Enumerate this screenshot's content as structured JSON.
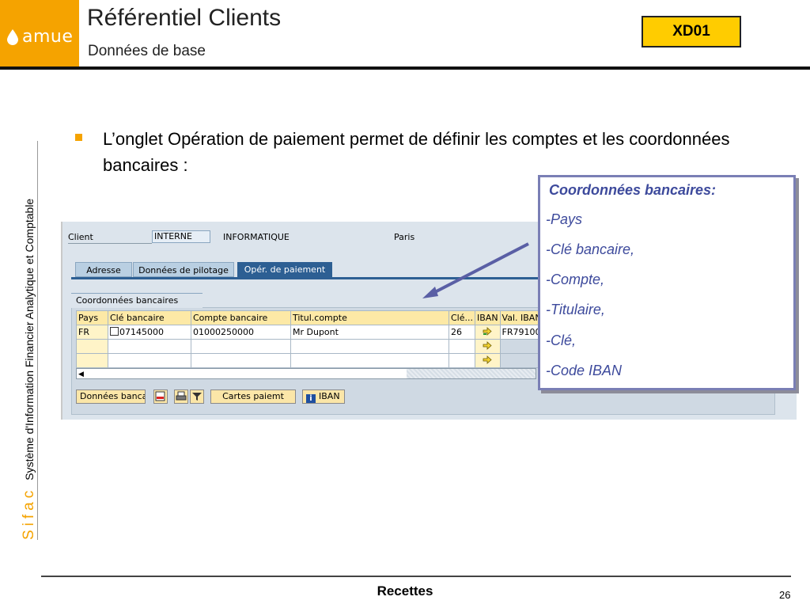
{
  "header": {
    "logo_text": "amue",
    "title": "Référentiel Clients",
    "subtitle": "Données de base",
    "transaction_code": "XD01"
  },
  "side": {
    "brand": "Sifac",
    "label": "Système d'Information Financier Analytique et Comptable"
  },
  "bullet_text": "L’onglet Opération de paiement permet de définir les comptes et les coordonnées bancaires :",
  "sap": {
    "client_label": "Client",
    "client_value": "INTERNE",
    "client_name": "INFORMATIQUE",
    "city": "Paris",
    "tabs": [
      {
        "label": "Adresse"
      },
      {
        "label": "Données de pilotage"
      },
      {
        "label": "Opér. de paiement",
        "active": true
      }
    ],
    "group_title": "Coordonnées bancaires",
    "table": {
      "headers": [
        "Pays",
        "Clé bancaire",
        "Compte bancaire",
        "Titul.compte",
        "Clé...",
        "IBAN",
        "Val. IBAN"
      ],
      "rows": [
        [
          "FR",
          "07145000",
          "01000250000",
          "Mr Dupont",
          "26",
          "",
          "FR79100"
        ],
        [
          "",
          "",
          "",
          "",
          "",
          "",
          ""
        ],
        [
          "",
          "",
          "",
          "",
          "",
          "",
          ""
        ]
      ]
    },
    "buttons": {
      "bank_data": "Données banca",
      "payment_cards": "Cartes paiemt",
      "iban": "IBAN"
    },
    "icons": [
      "delete-row-icon",
      "print-icon",
      "filter-icon",
      "info-icon",
      "iban-arrow-icon",
      "scroll-left-icon"
    ]
  },
  "callout": {
    "heading": "Coordonnées bancaires:",
    "items": [
      "-Pays",
      "-Clé bancaire,",
      "-Compte,",
      "-Titulaire,",
      "-Clé,",
      "-Code IBAN"
    ]
  },
  "footer": {
    "center": "Recettes",
    "page": "26"
  },
  "colors": {
    "brand_orange": "#f5a300",
    "tcode_yellow": "#ffcc00",
    "callout_blue": "#3d4a9c",
    "sap_tab_active": "#2d5f93"
  }
}
